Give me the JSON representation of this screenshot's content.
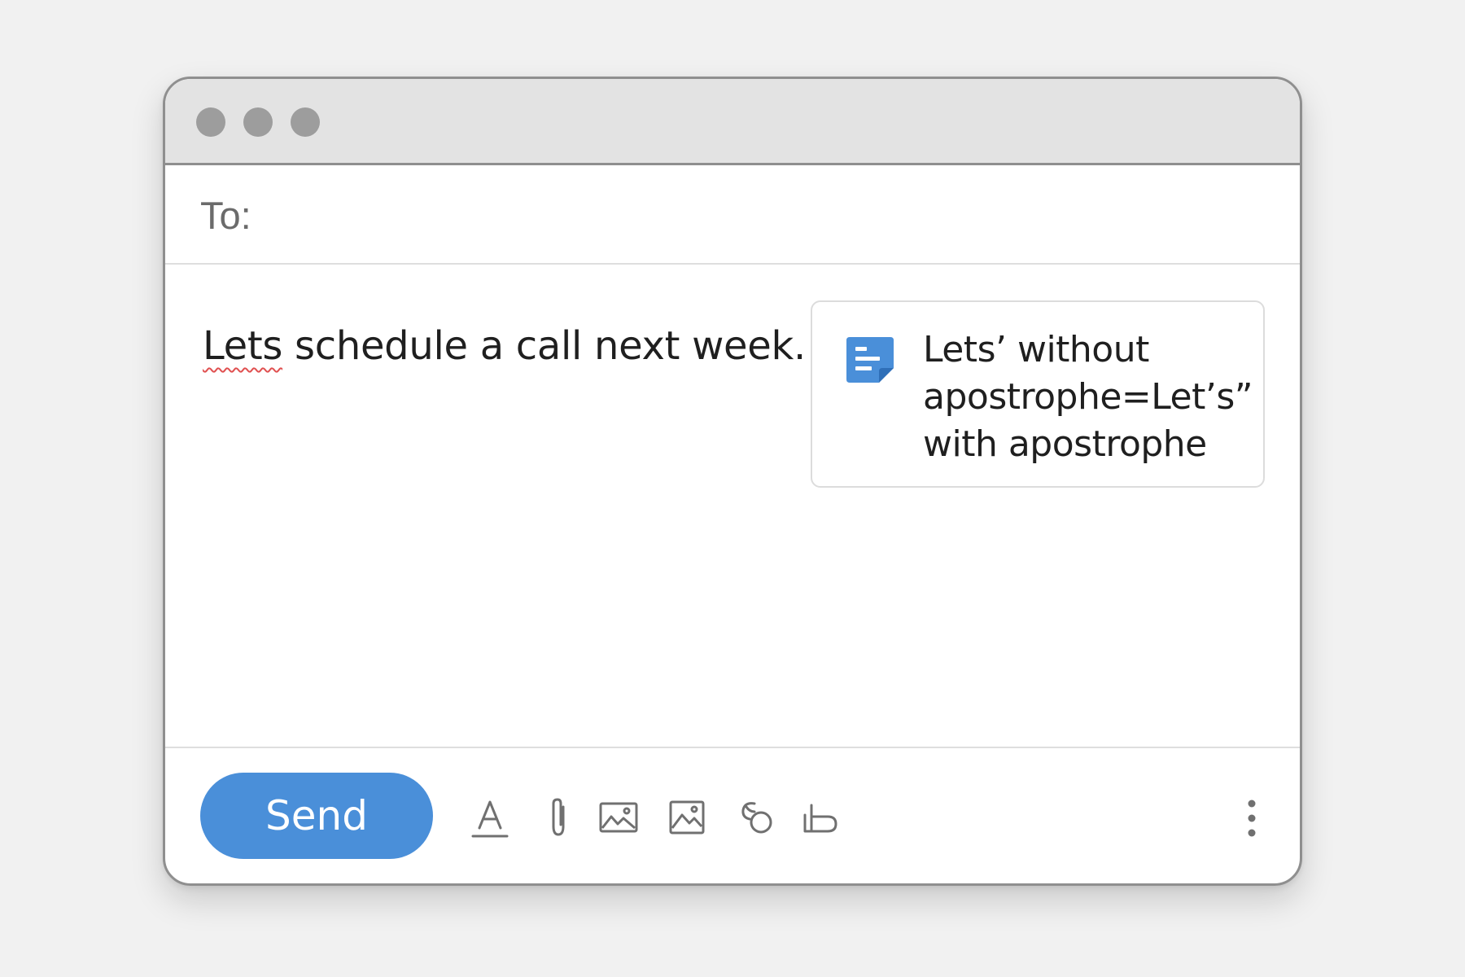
{
  "compose": {
    "to_label": "To:",
    "to_value": "",
    "body_misspelled_word": "Lets",
    "body_rest": " schedule a call next week.",
    "suggestion_text": "Lets’ without apostrophe=Let’s” with apostrophe",
    "suggestion_icon": "doc-icon",
    "send_label": "Send",
    "toolbar_icons": [
      "format-text-icon",
      "attach-icon",
      "photo-icon",
      "image-icon",
      "link-icon",
      "signature-icon",
      "more-options-icon"
    ]
  },
  "colors": {
    "accent": "#4a8fd9",
    "misspelling_underline": "#e05050",
    "titlebar": "#e3e3e3",
    "window_dots": "#9d9d9d"
  }
}
